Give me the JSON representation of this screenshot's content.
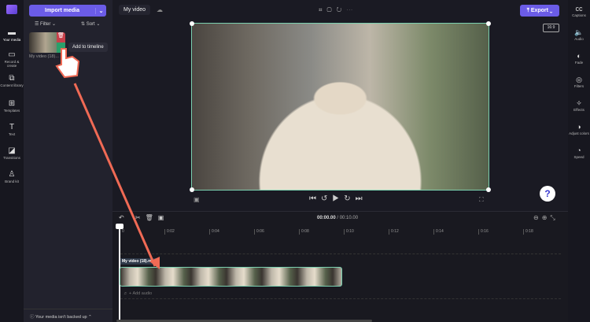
{
  "nav": [
    {
      "label": "Your media",
      "icon": "folder-icon"
    },
    {
      "label": "Record & create",
      "icon": "camera-icon"
    },
    {
      "label": "Content library",
      "icon": "library-icon"
    },
    {
      "label": "Templates",
      "icon": "templates-icon"
    },
    {
      "label": "Text",
      "icon": "text-icon"
    },
    {
      "label": "Transitions",
      "icon": "transitions-icon"
    },
    {
      "label": "Brand kit",
      "icon": "brand-icon"
    }
  ],
  "media": {
    "import_label": "Import media",
    "filter_label": "Filter",
    "sort_label": "Sort",
    "item_name": "My video (18)...",
    "tooltip": "Add to timeline",
    "backup_notice": "Your media isn't backed up"
  },
  "header": {
    "project_name": "My video",
    "export_label": "Export",
    "aspect_ratio": "16:9"
  },
  "player": {
    "current_time": "00:00.00",
    "total_time": "/ 00:10.00",
    "help": "?"
  },
  "timeline": {
    "ticks": [
      "0",
      "0:02",
      "0:04",
      "0:06",
      "0:08",
      "0:10",
      "0:12",
      "0:14",
      "0:16",
      "0:18"
    ],
    "clip_label": "My video (18).mp4",
    "add_audio": "+ Add audio"
  },
  "rightbar": [
    {
      "label": "Captions",
      "icon": "cc"
    },
    {
      "label": "Audio",
      "icon": "🔈"
    },
    {
      "label": "Fade",
      "icon": "◐"
    },
    {
      "label": "Filters",
      "icon": "◎"
    },
    {
      "label": "Effects",
      "icon": "✧"
    },
    {
      "label": "Adjust colors",
      "icon": "◑"
    },
    {
      "label": "Speed",
      "icon": "◔"
    }
  ]
}
